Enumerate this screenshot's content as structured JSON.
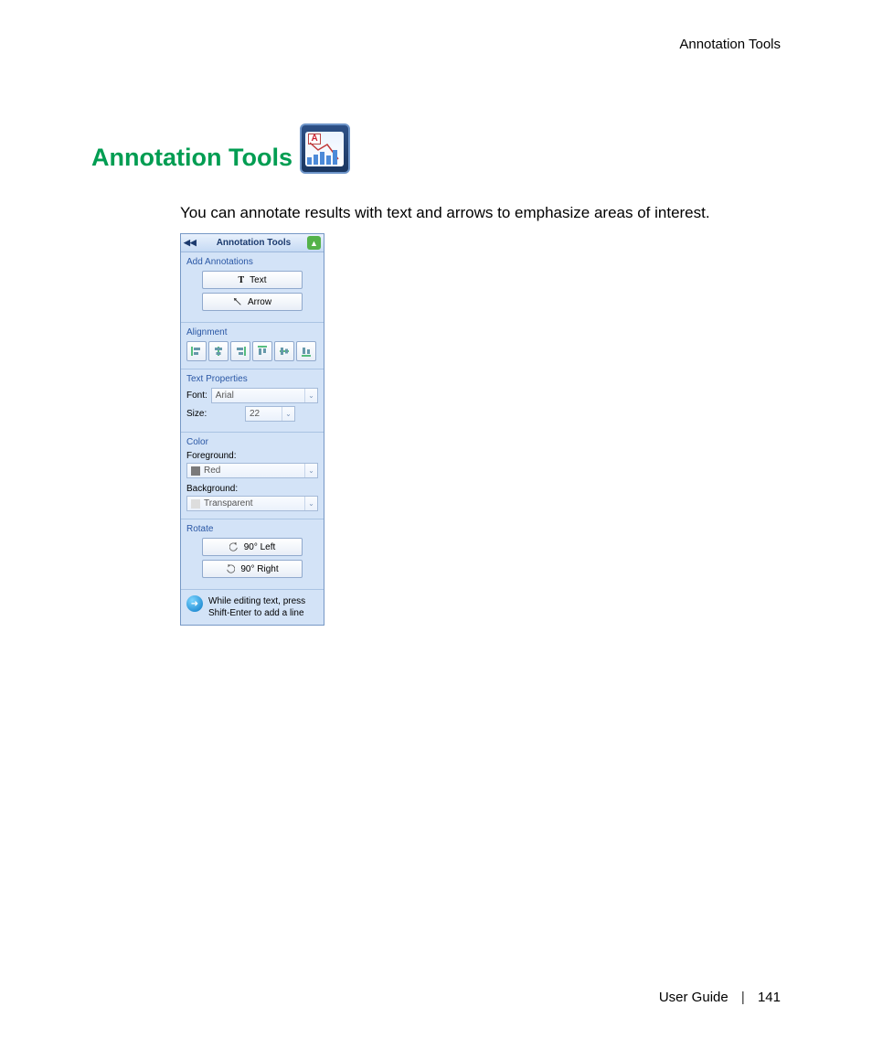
{
  "header": {
    "section": "Annotation Tools"
  },
  "title": "Annotation Tools",
  "intro": "You can annotate results with text and arrows to emphasize areas of interest.",
  "panel": {
    "title": "Annotation Tools",
    "add_annotations": {
      "title": "Add Annotations",
      "text_btn": "Text",
      "arrow_btn": "Arrow"
    },
    "alignment": {
      "title": "Alignment"
    },
    "text_properties": {
      "title": "Text Properties",
      "font_label": "Font:",
      "font_value": "Arial",
      "size_label": "Size:",
      "size_value": "22"
    },
    "color": {
      "title": "Color",
      "foreground_label": "Foreground:",
      "foreground_value": "Red",
      "background_label": "Background:",
      "background_value": "Transparent"
    },
    "rotate": {
      "title": "Rotate",
      "left_btn": "90° Left",
      "right_btn": "90° Right"
    },
    "tip": "While editing text, press Shift-Enter to add a line"
  },
  "footer": {
    "doc": "User Guide",
    "page": "141"
  }
}
